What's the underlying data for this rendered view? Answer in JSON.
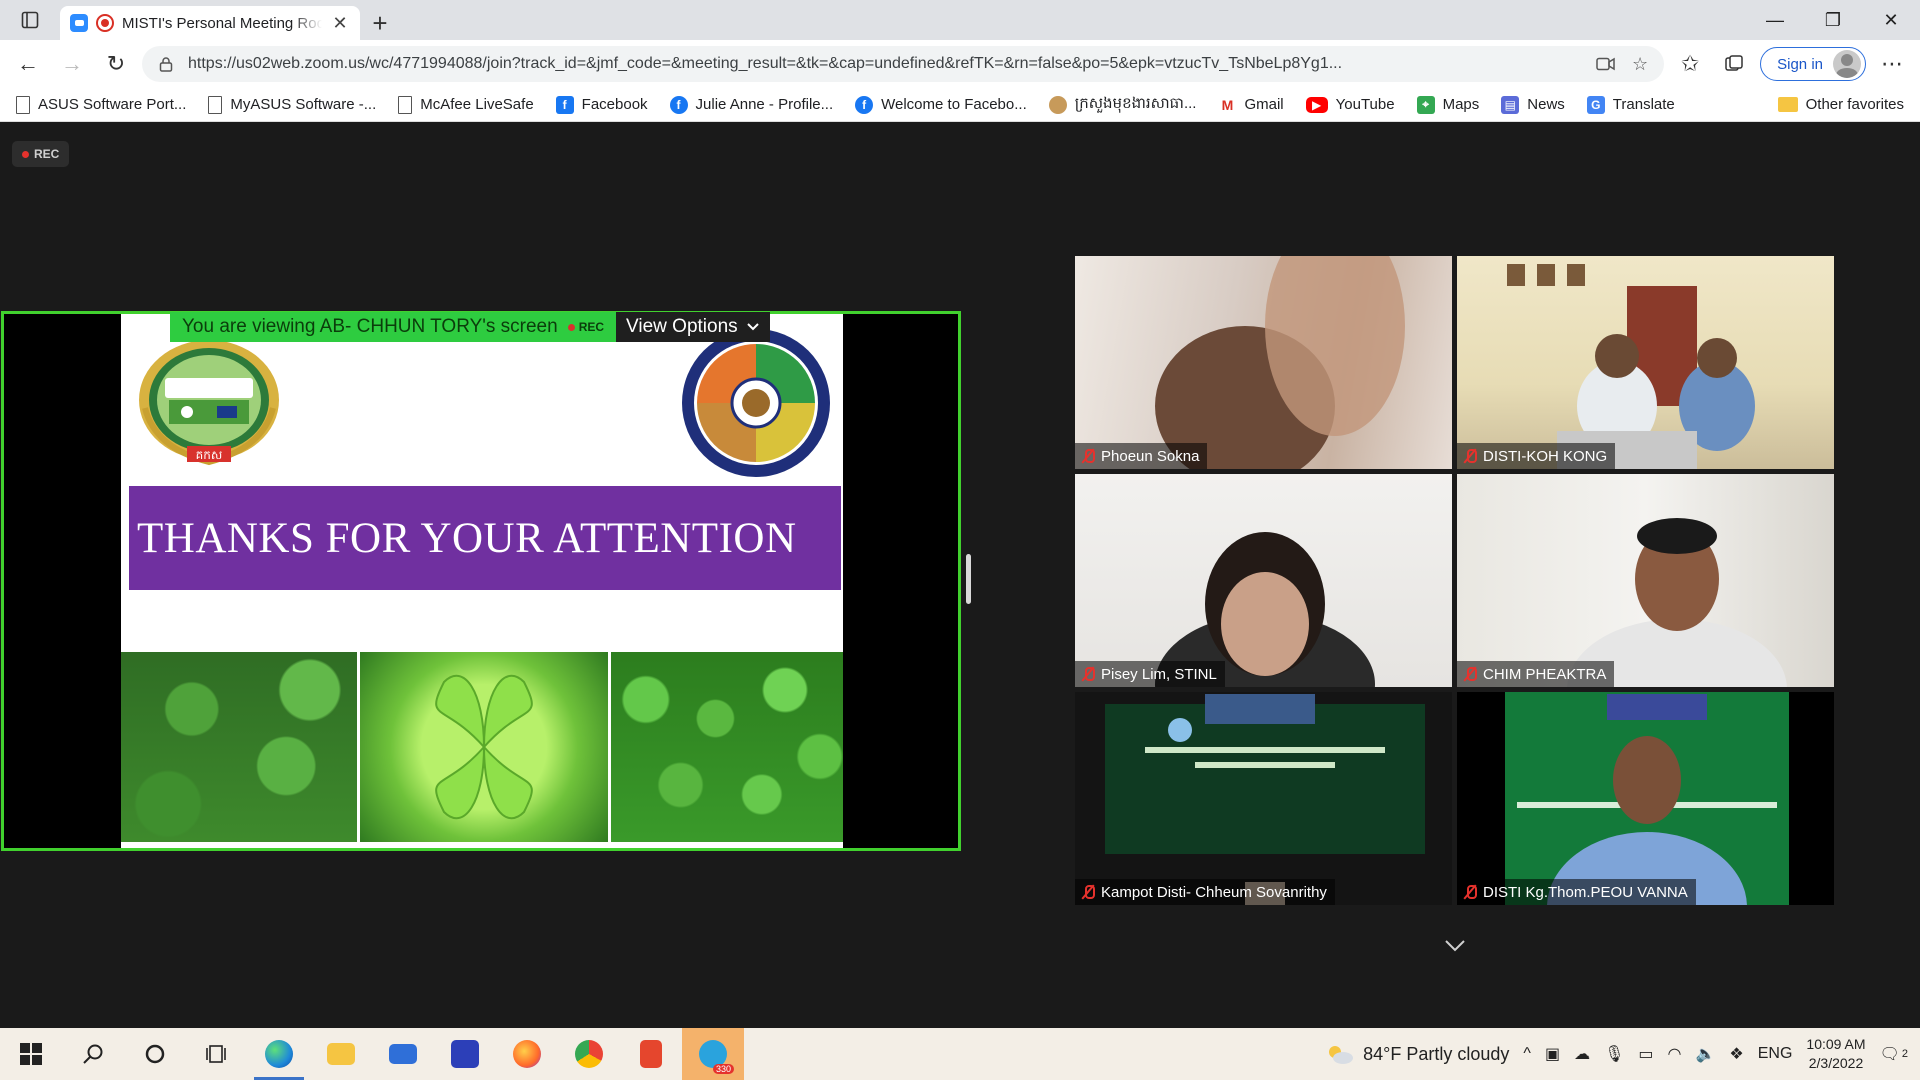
{
  "browser": {
    "tab_title": "MISTI's Personal Meeting Room",
    "url": "https://us02web.zoom.us/wc/4771994088/join?track_id=&jmf_code=&meeting_result=&tk=&cap=undefined&refTK=&rn=false&po=5&epk=vtzucTv_TsNbeLp8Yg1...",
    "sign_in_label": "Sign in",
    "favorites": [
      {
        "label": "ASUS Software Port...",
        "icon": "page-icon"
      },
      {
        "label": "MyASUS Software -...",
        "icon": "page-icon"
      },
      {
        "label": "McAfee LiveSafe",
        "icon": "page-icon"
      },
      {
        "label": "Facebook",
        "icon": "facebook-icon"
      },
      {
        "label": "Julie Anne - Profile...",
        "icon": "facebook-icon"
      },
      {
        "label": "Welcome to Facebo...",
        "icon": "facebook-icon"
      },
      {
        "label": "ក្រសួងមុខងារសាធា...",
        "icon": "seal-icon"
      },
      {
        "label": "Gmail",
        "icon": "gmail-icon"
      },
      {
        "label": "YouTube",
        "icon": "youtube-icon"
      },
      {
        "label": "Maps",
        "icon": "maps-icon"
      },
      {
        "label": "News",
        "icon": "news-icon"
      },
      {
        "label": "Translate",
        "icon": "translate-icon"
      }
    ],
    "other_favorites": "Other favorites"
  },
  "meeting": {
    "rec_label": "REC",
    "viewing_text": "You are viewing AB- CHHUN TORY's screen",
    "viewing_rec": "REC",
    "view_options": "View Options",
    "slide": {
      "banner_text": "THANKS FOR YOUR ATTENTION",
      "left_logo_text": "គកស"
    },
    "participants": [
      {
        "name": "Phoeun Sokna"
      },
      {
        "name": "DISTI-KOH KONG"
      },
      {
        "name": "Pisey Lim, STINL"
      },
      {
        "name": "CHIM PHEAKTRA"
      },
      {
        "name": "Kampot Disti- Chheum Sovanrithy"
      },
      {
        "name": "DISTI Kg.Thom.PEOU VANNA"
      }
    ]
  },
  "taskbar": {
    "weather": "84°F  Partly cloudy",
    "language": "ENG",
    "time": "10:09 AM",
    "date": "2/3/2022",
    "telegram_badge": "330",
    "notifications": "2"
  },
  "colors": {
    "share_border": "#41d12e",
    "banner": "#7030a0",
    "viewing_bar": "#2ecc40"
  }
}
